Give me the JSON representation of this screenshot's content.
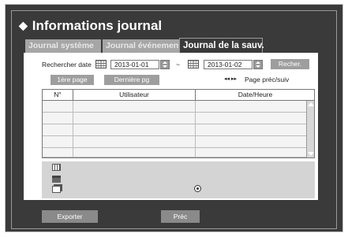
{
  "window": {
    "title": "Informations journal"
  },
  "tabs": [
    {
      "label": "Journal système",
      "active": false
    },
    {
      "label": "Journal événements",
      "active": false
    },
    {
      "label": "Journal de la sauv.",
      "active": true
    }
  ],
  "search": {
    "label": "Rechercher date",
    "start_date": "2013-01-01",
    "separator": "~",
    "end_date": "2013-01-02",
    "button": "Recher."
  },
  "paging": {
    "first_page": "1ère page",
    "last_page": "Dernière pg",
    "nav_arrows": "◂◂ ▸▸",
    "nav_label": "Page préc/suiv"
  },
  "table": {
    "columns": [
      "N°",
      "Utilisateur",
      "Date/Heure"
    ],
    "rows": [
      [
        "",
        "",
        ""
      ],
      [
        "",
        "",
        ""
      ],
      [
        "",
        "",
        ""
      ],
      [
        "",
        "",
        ""
      ],
      [
        "",
        "",
        ""
      ]
    ]
  },
  "preview": {
    "icons": [
      "calendar-icon",
      "storage-device-icon",
      "copy-icon"
    ]
  },
  "footer": {
    "export_label": "Exporter",
    "prev_label": "Préc"
  },
  "colors": {
    "background": "#3a3a3a",
    "tab_inactive": "#a6a6a6",
    "button": "#9e9e9e"
  }
}
